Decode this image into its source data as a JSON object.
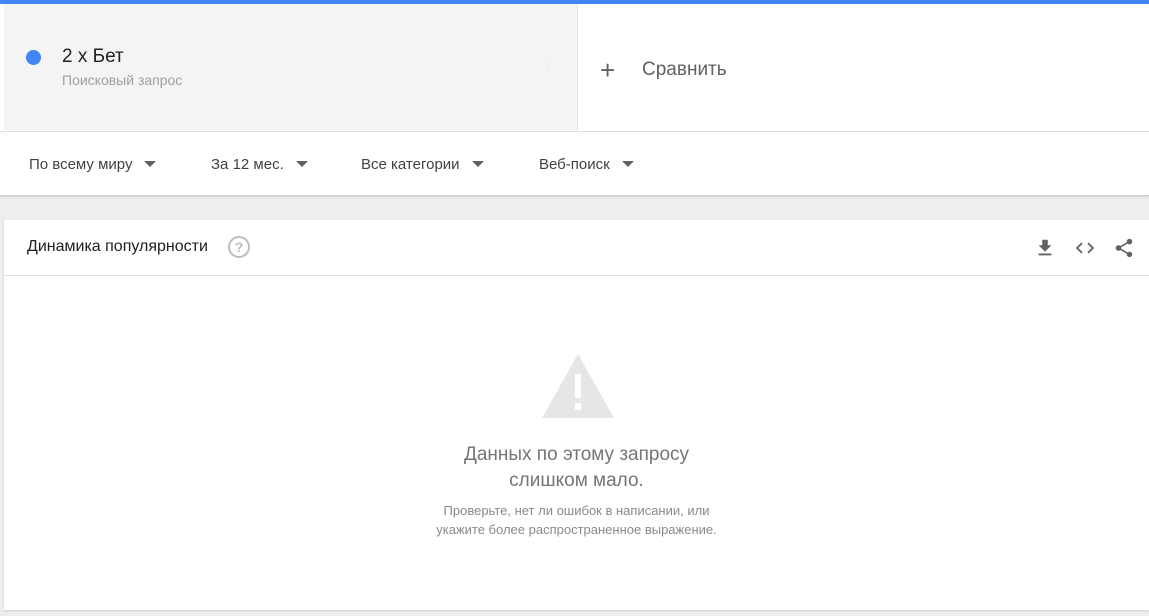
{
  "search_term": {
    "name": "2 x Бет",
    "type": "Поисковый запрос",
    "color": "#4285f4"
  },
  "compare": {
    "label": "Сравнить"
  },
  "filters": {
    "region": "По всему миру",
    "period": "За 12 мес.",
    "category": "Все категории",
    "search_type": "Веб-поиск"
  },
  "panel": {
    "title": "Динамика популярности",
    "icons": [
      "help-icon",
      "download-icon",
      "embed-code-icon",
      "share-icon"
    ],
    "empty_state": {
      "title_line1": "Данных по этому запросу",
      "title_line2": "слишком мало.",
      "subtitle_line1": "Проверьте, нет ли ошибок в написании, или",
      "subtitle_line2": "укажите более распространенное выражение."
    }
  },
  "colors": {
    "accent": "#4285f4",
    "page_background": "#eeeeee",
    "term_card_background": "#f4f4f4"
  }
}
